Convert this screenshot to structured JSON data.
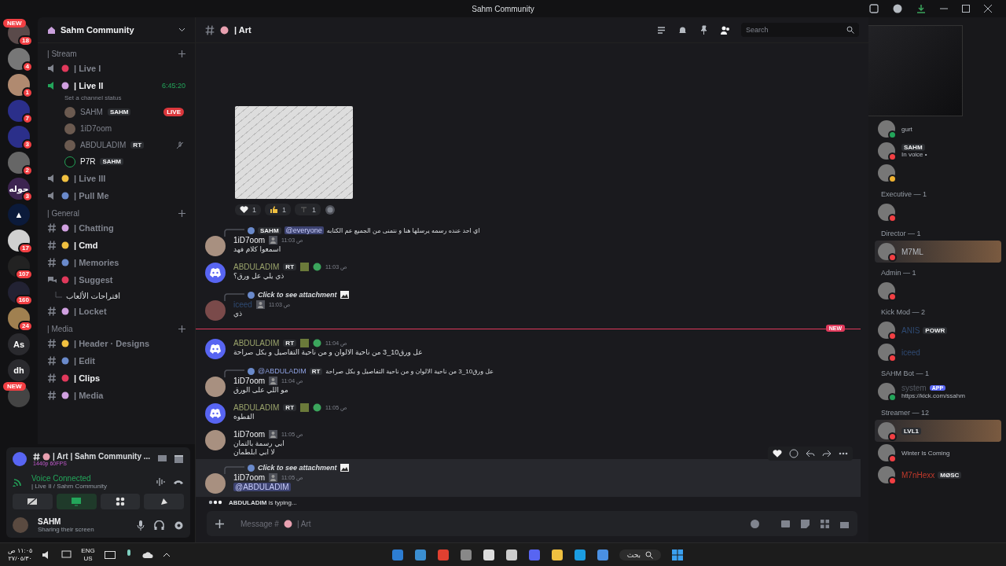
{
  "window": {
    "title": "Sahm Community"
  },
  "servers": [
    {
      "tag": "NEW",
      "badge": "18"
    },
    {
      "badge": "4"
    },
    {
      "badge": "1"
    },
    {
      "badge": "7"
    },
    {
      "badge": "3"
    },
    {
      "badge": "2"
    },
    {
      "label": "حوله",
      "badge": "3"
    },
    {
      "label": "▲"
    },
    {
      "badge": "17"
    },
    {
      "badge": "107"
    },
    {
      "badge": "160"
    },
    {
      "badge": "24"
    },
    {
      "label": "As"
    },
    {
      "label": "dh"
    },
    {
      "tag": "NEW"
    }
  ],
  "server": {
    "name": "Sahm Community",
    "categories": [
      {
        "name": "| Stream",
        "channels": [
          {
            "kind": "voice",
            "name": "| Live I",
            "unread": false,
            "connected": false
          },
          {
            "kind": "voice",
            "name": "| Live II",
            "unread": true,
            "connected": true,
            "timer": "6:45:20",
            "status_hint": "Set a channel status",
            "users": [
              {
                "name": "SAHM",
                "tag": "SAHM",
                "live": "LIVE",
                "speaking": false
              },
              {
                "name": "1iD7oom",
                "speaking": false
              },
              {
                "name": "ABDULADIM",
                "tag": "RT",
                "muted": true,
                "speaking": false
              },
              {
                "name": "P7R",
                "tag": "SAHM",
                "speaking": true
              }
            ]
          },
          {
            "kind": "voice",
            "name": "| Live III",
            "unread": false,
            "connected": false
          },
          {
            "kind": "voice",
            "name": "| Pull Me",
            "unread": false,
            "connected": false
          }
        ]
      },
      {
        "name": "| General",
        "channels": [
          {
            "kind": "text",
            "name": "| Chatting",
            "unread": false
          },
          {
            "kind": "text",
            "name": "| Cmd",
            "unread": true
          },
          {
            "kind": "text",
            "name": "| Memories",
            "unread": false
          },
          {
            "kind": "forum",
            "name": "| Suggest",
            "unread": false,
            "threads": [
              "اقتراحات الألعاب"
            ]
          },
          {
            "kind": "text",
            "name": "| Locket",
            "unread": false
          }
        ]
      },
      {
        "name": "| Media",
        "channels": [
          {
            "kind": "text",
            "name": "| Header · Designs",
            "unread": false
          },
          {
            "kind": "text",
            "name": "| Edit",
            "unread": false
          },
          {
            "kind": "text",
            "name": "| Clips",
            "unread": true
          },
          {
            "kind": "text",
            "name": "| Media",
            "unread": false
          }
        ]
      }
    ]
  },
  "stream_panel": {
    "channel": "| Art | Sahm Community ...",
    "quality": "1440p 60FPS"
  },
  "voice": {
    "status": "Voice Connected",
    "location": "| Live II / Sahm Community"
  },
  "user": {
    "name": "SAHM",
    "status": "Sharing their screen"
  },
  "chat": {
    "channel": "| Art",
    "search_placeholder": "Search",
    "messages": [
      {
        "kind": "attachment",
        "reactions": [
          {
            "kind": "heart",
            "count": "1"
          },
          {
            "kind": "thumbs",
            "count": "1"
          },
          {
            "kind": "other",
            "count": "1"
          }
        ]
      },
      {
        "kind": "message",
        "avatar": {
          "kind": "anime"
        },
        "author": "1iD7oom",
        "time": "11:03 ص",
        "reply": {
          "kind": "text",
          "tag": "SAHM",
          "mention": "@everyone",
          "text": "اي احد عنده رسمه يرسلها هنا و نتمنى من الجميع عم الكتابه"
        },
        "lines": [
          "اسمعوا كلام فهد"
        ]
      },
      {
        "kind": "message",
        "avatar": {
          "kind": "discord"
        },
        "author": "ABDULADIM",
        "role_tag": "RT",
        "color": "#9aa36b",
        "time": "11:03 ص",
        "lines": [
          "ذي يلي عل ورق؟"
        ]
      },
      {
        "kind": "message",
        "avatar": {
          "kind": "photo"
        },
        "author": "iceed",
        "color": "#2f4a72",
        "time": "11:03 ص",
        "reply": {
          "kind": "attachment",
          "text": "Click to see attachment"
        },
        "lines": [
          "ذي"
        ]
      },
      {
        "kind": "divider",
        "label": "NEW"
      },
      {
        "kind": "message",
        "avatar": {
          "kind": "discord"
        },
        "author": "ABDULADIM",
        "role_tag": "RT",
        "color": "#9aa36b",
        "time": "11:04 ص",
        "lines": [
          "عل ورق10_3 من ناحية الالوان و من ناحية التفاصيل و بكل صراحة"
        ]
      },
      {
        "kind": "message",
        "avatar": {
          "kind": "anime"
        },
        "author": "1iD7oom",
        "time": "11:04 ص",
        "reply": {
          "kind": "text",
          "author": "@ABDULADIM",
          "tag": "RT",
          "text": "عل ورق10_3 من ناحية الالوان و من ناحية التفاصيل و بكل صراحة"
        },
        "lines": [
          "مو اللي على الورق"
        ]
      },
      {
        "kind": "message",
        "avatar": {
          "kind": "discord"
        },
        "author": "ABDULADIM",
        "role_tag": "RT",
        "color": "#9aa36b",
        "time": "11:05 ص",
        "lines": [
          "القطوه"
        ]
      },
      {
        "kind": "message",
        "avatar": {
          "kind": "anime"
        },
        "author": "1iD7oom",
        "time": "11:05 ص",
        "lines": [
          "ابي رسمة بالتمان",
          "لا ابي ابلطمان"
        ]
      },
      {
        "kind": "message",
        "avatar": {
          "kind": "anime"
        },
        "author": "1iD7oom",
        "time": "11:05 ص",
        "hovered": true,
        "reply": {
          "kind": "attachment",
          "text": "Click to see attachment"
        },
        "mention_line": "@ABDULADIM"
      }
    ],
    "typing": {
      "name": "ABDULADIM",
      "text": "is typing..."
    },
    "input": {
      "prefix": "Message #",
      "channel": "| Art"
    }
  },
  "members": [
    {
      "members": [
        {
          "status": {
            "kind": "online"
          },
          "activity": "gurt"
        },
        {
          "status": {
            "kind": "dnd"
          },
          "tag": "SAHM",
          "activity": "In voice •"
        },
        {
          "status": {
            "kind": "idle"
          }
        }
      ]
    },
    {
      "title": "Executive — 1",
      "members": [
        {
          "status": {
            "kind": "dnd"
          }
        }
      ]
    },
    {
      "title": "Director — 1",
      "members": [
        {
          "status": {
            "kind": "dnd"
          },
          "name": "M7ML",
          "highlighted": true
        }
      ]
    },
    {
      "title": "Admin — 1",
      "members": [
        {
          "status": {
            "kind": "dnd"
          }
        }
      ]
    },
    {
      "title": "Kick Mod — 2",
      "members": [
        {
          "status": {
            "kind": "dnd"
          },
          "name": "ANIS",
          "tag": "POWR",
          "color": "#2f4a72"
        },
        {
          "status": {
            "kind": "dnd"
          },
          "name": "iceed",
          "color": "#2f4a72"
        }
      ]
    },
    {
      "title": "SAHM Bot — 1",
      "members": [
        {
          "status": {
            "kind": "online"
          },
          "name": "system",
          "app": "APP",
          "activity": "https://kick.com/ssahm",
          "color": "#555a63"
        }
      ]
    },
    {
      "title": "Streamer — 12",
      "members": [
        {
          "status": {
            "kind": "dnd"
          },
          "tag": "LVL1",
          "highlighted": true
        },
        {
          "status": {
            "kind": "dnd"
          },
          "activity": "Winter Is Coming"
        },
        {
          "status": {
            "kind": "dnd"
          },
          "name": "M7nHexx",
          "tag": "MØSC",
          "color": "#c0392b"
        }
      ]
    }
  ],
  "taskbar": {
    "time": "١١:٠٥ ص",
    "date": "٢٧/٠٥/٣٠",
    "lang": "ENG",
    "region": "US",
    "search": "بحث"
  }
}
